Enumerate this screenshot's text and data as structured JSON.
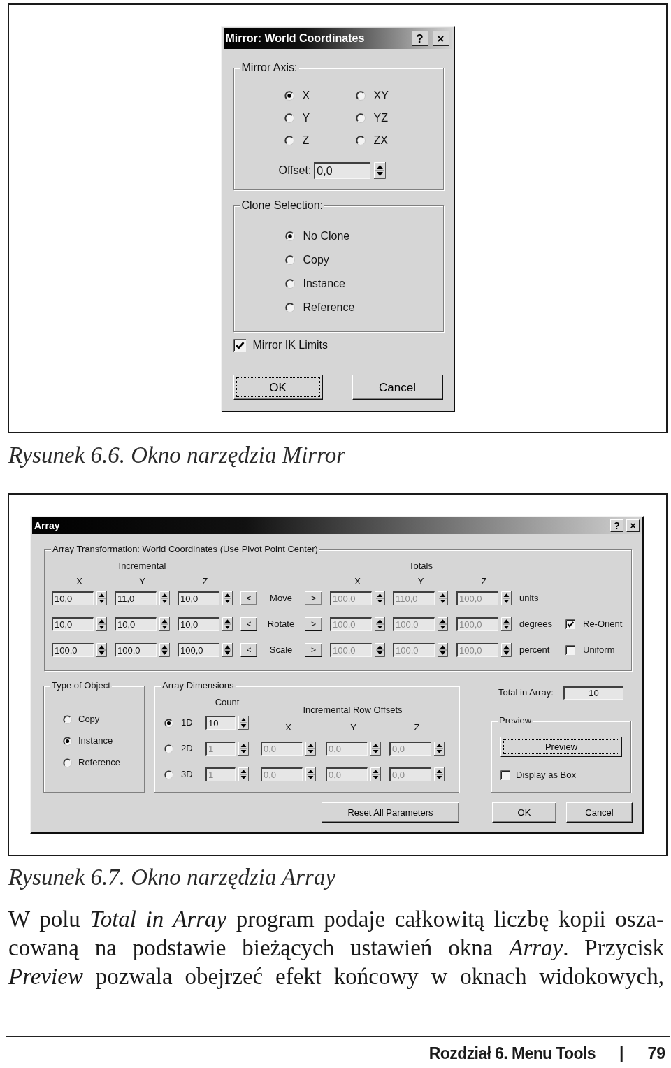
{
  "mirror_figure": {
    "dialog": {
      "title": "Mirror: World Coordinates",
      "help_button": "?",
      "close_button": "×",
      "mirror_axis": {
        "label": "Mirror Axis:",
        "options": [
          {
            "label": "X",
            "selected": true
          },
          {
            "label": "XY",
            "selected": false
          },
          {
            "label": "Y",
            "selected": false
          },
          {
            "label": "YZ",
            "selected": false
          },
          {
            "label": "Z",
            "selected": false
          },
          {
            "label": "ZX",
            "selected": false
          }
        ],
        "offset": {
          "label": "Offset:",
          "value": "0,0"
        }
      },
      "clone_selection": {
        "label": "Clone Selection:",
        "options": [
          {
            "label": "No Clone",
            "selected": true
          },
          {
            "label": "Copy",
            "selected": false
          },
          {
            "label": "Instance",
            "selected": false
          },
          {
            "label": "Reference",
            "selected": false
          }
        ]
      },
      "mirror_ik_limits": {
        "label": "Mirror IK Limits",
        "checked": true
      },
      "buttons": [
        {
          "label": "OK",
          "focused": true
        },
        {
          "label": "Cancel",
          "focused": false
        }
      ]
    },
    "caption": "Rysunek 6.6. Okno narzędzia Mirror"
  },
  "array_figure": {
    "dialog": {
      "title": "Array",
      "help_button": "?",
      "close_button": "×",
      "transformation": {
        "label": "Array Transformation: World Coordinates (Use Pivot Point Center)",
        "incremental_label": "Incremental",
        "totals_label": "Totals",
        "incremental_axes": [
          "X",
          "Y",
          "Z"
        ],
        "totals_axes": [
          "X",
          "Y",
          "Z"
        ],
        "rows": [
          {
            "label": "Move",
            "left_button": "<",
            "right_button": ">",
            "incremental": [
              {
                "value": "10,0",
                "disabled": false
              },
              {
                "value": "11,0",
                "disabled": false
              },
              {
                "value": "10,0",
                "disabled": false
              }
            ],
            "totals": [
              {
                "value": "100,0",
                "disabled": true
              },
              {
                "value": "110,0",
                "disabled": true
              },
              {
                "value": "100,0",
                "disabled": true
              }
            ],
            "unit": "units"
          },
          {
            "label": "Rotate",
            "left_button": "<",
            "right_button": ">",
            "incremental": [
              {
                "value": "10,0",
                "disabled": false
              },
              {
                "value": "10,0",
                "disabled": false
              },
              {
                "value": "10,0",
                "disabled": false
              }
            ],
            "totals": [
              {
                "value": "100,0",
                "disabled": true
              },
              {
                "value": "100,0",
                "disabled": true
              },
              {
                "value": "100,0",
                "disabled": true
              }
            ],
            "unit": "degrees",
            "option": {
              "label": "Re-Orient",
              "checked": true
            }
          },
          {
            "label": "Scale",
            "left_button": "<",
            "right_button": ">",
            "incremental": [
              {
                "value": "100,0",
                "disabled": false
              },
              {
                "value": "100,0",
                "disabled": false
              },
              {
                "value": "100,0",
                "disabled": false
              }
            ],
            "totals": [
              {
                "value": "100,0",
                "disabled": true
              },
              {
                "value": "100,0",
                "disabled": true
              },
              {
                "value": "100,0",
                "disabled": true
              }
            ],
            "unit": "percent",
            "option": {
              "label": "Uniform",
              "checked": false
            }
          }
        ]
      },
      "type_of_object": {
        "label": "Type of Object",
        "options": [
          {
            "label": "Copy",
            "selected": false
          },
          {
            "label": "Instance",
            "selected": true
          },
          {
            "label": "Reference",
            "selected": false
          }
        ]
      },
      "array_dimensions": {
        "label": "Array Dimensions",
        "count_label": "Count",
        "offsets_label": "Incremental Row Offsets",
        "offset_axes": [
          "X",
          "Y",
          "Z"
        ],
        "rows": [
          {
            "label": "1D",
            "selected": true,
            "count": {
              "value": "10",
              "disabled": false
            }
          },
          {
            "label": "2D",
            "selected": false,
            "count": {
              "value": "1",
              "disabled": true
            },
            "offsets": [
              {
                "value": "0,0",
                "disabled": true
              },
              {
                "value": "0,0",
                "disabled": true
              },
              {
                "value": "0,0",
                "disabled": true
              }
            ]
          },
          {
            "label": "3D",
            "selected": false,
            "count": {
              "value": "1",
              "disabled": true
            },
            "offsets": [
              {
                "value": "0,0",
                "disabled": true
              },
              {
                "value": "0,0",
                "disabled": true
              },
              {
                "value": "0,0",
                "disabled": true
              }
            ]
          }
        ]
      },
      "total_in_array": {
        "label": "Total in Array:",
        "value": "10"
      },
      "preview": {
        "label": "Preview",
        "button": {
          "label": "Preview",
          "focused": true
        },
        "display_as_box": {
          "label": "Display as Box",
          "checked": false
        }
      },
      "buttons": [
        {
          "label": "Reset All Parameters",
          "focused": false
        },
        {
          "label": "OK",
          "focused": false
        },
        {
          "label": "Cancel",
          "focused": false
        }
      ]
    },
    "caption": "Rysunek 6.7. Okno narzędzia Array"
  },
  "paragraph": {
    "lines": [
      "W polu *Total in Array* program podaje całkowitą liczbę kopii osza-",
      "cowaną na podstawie bieżących ustawień okna *Array*. Przycisk",
      "*Preview* pozwala obejrzeć efekt końcowy w oknach widokowych,"
    ]
  },
  "footer": {
    "chapter": "Rozdział 6. Menu Tools",
    "separator": "|",
    "page": "79"
  }
}
